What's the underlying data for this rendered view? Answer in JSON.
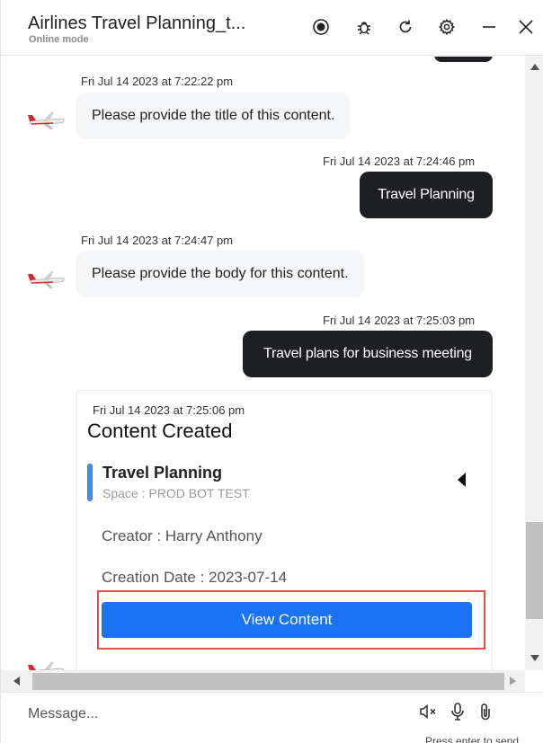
{
  "header": {
    "title": "Airlines Travel Planning_t...",
    "subtitle": "Online mode"
  },
  "messages": [
    {
      "timestamp": "Fri Jul 14 2023 at 7:22:22 pm",
      "text": "Please provide the title of this content."
    },
    {
      "timestamp": "Fri Jul 14 2023 at 7:24:46 pm",
      "text": "Travel Planning"
    },
    {
      "timestamp": "Fri Jul 14 2023 at 7:24:47 pm",
      "text": "Please provide the body for this content."
    },
    {
      "timestamp": "Fri Jul 14 2023 at 7:25:03 pm",
      "text": "Travel plans for business meeting"
    }
  ],
  "card": {
    "timestamp": "Fri Jul 14 2023 at 7:25:06 pm",
    "title": "Content Created",
    "item_title": "Travel Planning",
    "item_space": "Space : PROD BOT TEST",
    "creator": "Creator : Harry Anthony",
    "creation_date": "Creation Date : 2023-07-14",
    "button_label": "View Content"
  },
  "composer": {
    "placeholder": "Message...",
    "hint": "Press enter to send"
  },
  "icons": [
    "record-icon",
    "bug-icon",
    "refresh-icon",
    "settings-icon",
    "minimize-icon",
    "close-icon",
    "mute-icon",
    "microphone-icon",
    "attachment-icon",
    "airplane-avatar-icon"
  ],
  "colors": {
    "accent": "#1a73f5",
    "user_bubble": "#1e1f22",
    "highlight": "#e0504b"
  }
}
